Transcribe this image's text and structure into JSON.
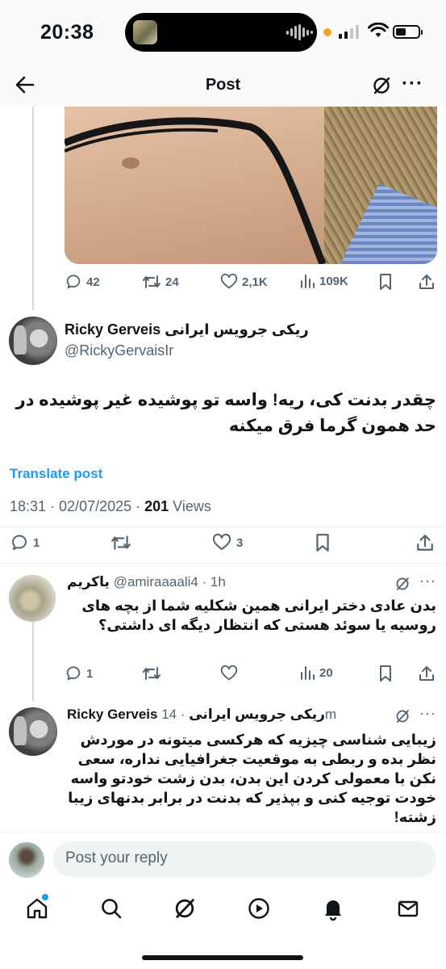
{
  "status_bar": {
    "time": "20:38",
    "icons": [
      "music-thumbnail-icon",
      "audio-waveform-icon",
      "mic-indicator-icon",
      "cellular-signal-icon",
      "wifi-icon",
      "battery-icon"
    ]
  },
  "header": {
    "title": "Post",
    "icons": [
      "back-arrow-icon",
      "grok-icon",
      "more-icon"
    ]
  },
  "parent_post": {
    "stats": {
      "replies": "42",
      "reposts": "24",
      "likes": "2,1K",
      "views": "109K"
    }
  },
  "main_post": {
    "display_name": "Ricky Gerveis ریکی جرویس ایرانی",
    "handle": "@RickyGervaisIr",
    "text": "چقدر بدنت کی، ریه! واسه تو پوشیده غیر پوشیده در حد همون گرما فرق میکنه",
    "translate_label": "Translate post",
    "timestamp": "18:31 · 02/07/2025 · ",
    "views_count": "201",
    "views_label": " Views",
    "stats": {
      "replies": "1",
      "reposts": "",
      "likes": "3"
    }
  },
  "replies": [
    {
      "display_name": "یاکریم",
      "handle": "@amiraaaali4 · 1h",
      "text": "بدن عادی دختر ایرانی همین شکلیه شما از بچه های روسیه یا سوئد هستی که انتظار دیگه ای داشتی؟",
      "stats": {
        "replies": "1",
        "views": "20"
      }
    },
    {
      "display_name": "Ricky Gerveis ریکی جرویس ایرانی",
      "handle": " · 14m",
      "text": "زیبایی شناسی چیزیه که هرکسی میتونه در موردش نظر بده و ربطی به موقعیت جغرافیایی نداره، سعی نکن با معمولی کردن این بدن، بدن زشت خودتو واسه خودت توجیه کنی و بپذیر که بدنت در برابر بدنهای زیبا زشته!"
    }
  ],
  "reply_bar": {
    "placeholder": "Post your reply"
  },
  "bottom_nav": {
    "items": [
      "home-icon",
      "search-icon",
      "grok-icon",
      "video-icon",
      "notifications-icon",
      "messages-icon"
    ],
    "accent": "#1d9bf0"
  },
  "colors": {
    "link": "#1d9bf0",
    "secondary_text": "#536471",
    "primary_text": "#0f1419"
  }
}
